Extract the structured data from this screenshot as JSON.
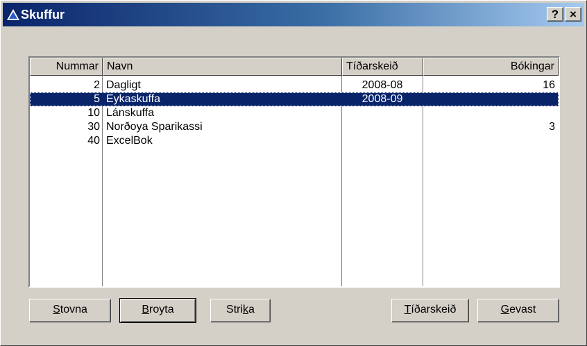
{
  "window": {
    "title": "Skuffur",
    "help_label": "?",
    "close_label": "×"
  },
  "columns": [
    "Nummar",
    "Navn",
    "Tíðarskeið",
    "Bókingar"
  ],
  "rows": [
    {
      "nummar": "2",
      "navn": "Dagligt",
      "tidarskeid": "2008-08",
      "bokingar": "16",
      "selected": false
    },
    {
      "nummar": "5",
      "navn": "Eykaskuffa",
      "tidarskeid": "2008-09",
      "bokingar": "",
      "selected": true
    },
    {
      "nummar": "10",
      "navn": "Lánskuffa",
      "tidarskeid": "",
      "bokingar": "",
      "selected": false
    },
    {
      "nummar": "30",
      "navn": "Norðoya Sparikassi",
      "tidarskeid": "",
      "bokingar": "3",
      "selected": false
    },
    {
      "nummar": "40",
      "navn": "ExcelBok",
      "tidarskeid": "",
      "bokingar": "",
      "selected": false
    }
  ],
  "buttons": {
    "stovna": {
      "mnemonic": "S",
      "rest": "tovna"
    },
    "broyta": {
      "mnemonic": "B",
      "rest": "royta"
    },
    "strika": {
      "pre": "Stri",
      "mnemonic": "k",
      "rest": "a"
    },
    "tidarskeid": {
      "mnemonic": "T",
      "rest": "íðarskeið"
    },
    "gevast": {
      "mnemonic": "G",
      "rest": "evast"
    }
  },
  "colors": {
    "selection": "#0a246a",
    "titlebar_start": "#0a246a",
    "titlebar_end": "#a6caf0",
    "face": "#d4d0c8"
  },
  "icons": [
    "app-triangle-icon"
  ]
}
